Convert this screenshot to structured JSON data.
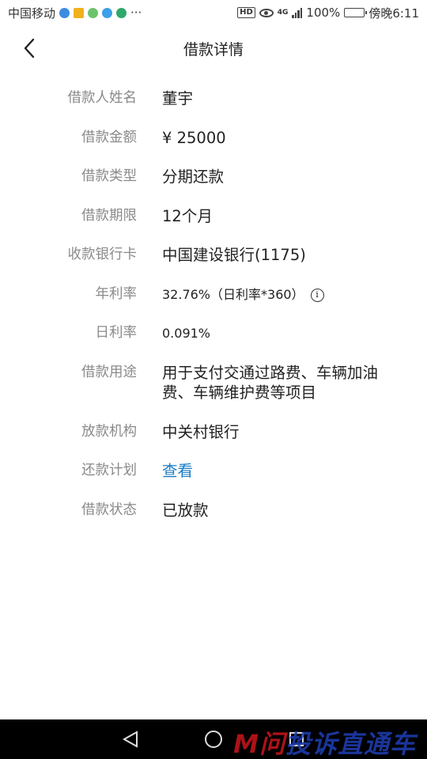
{
  "status_bar": {
    "carrier": "中国移动",
    "more": "···",
    "hd_badge": "HD",
    "network": "4G",
    "battery": "100%",
    "time": "傍晚6:11",
    "battery_level": 1.0
  },
  "header": {
    "title": "借款详情",
    "back_icon": "chevron-left-icon"
  },
  "details": [
    {
      "label": "借款人姓名",
      "value": "董宇"
    },
    {
      "label": "借款金额",
      "value": "¥ 25000"
    },
    {
      "label": "借款类型",
      "value": "分期还款"
    },
    {
      "label": "借款期限",
      "value": "12个月"
    },
    {
      "label": "收款银行卡",
      "value": "中国建设银行(1175)"
    },
    {
      "label": "年利率",
      "value": "32.76%（日利率*360）",
      "info_glyph": "i"
    },
    {
      "label": "日利率",
      "value": "0.091%"
    },
    {
      "label": "借款用途",
      "value": "用于支付交通过路费、车辆加油费、车辆维护费等项目"
    },
    {
      "label": "放款机构",
      "value": "中关村银行"
    },
    {
      "label": "还款计划",
      "value": "查看"
    },
    {
      "label": "借款状态",
      "value": "已放款"
    }
  ],
  "nav_bar": {
    "back": "back-triangle-icon",
    "home": "home-circle-icon",
    "recents": "recents-square-icon"
  },
  "watermark": {
    "part_a": "M问",
    "part_b": "投诉直通车"
  },
  "colors": {
    "link": "#1a7cc5",
    "label": "#8a8a8a",
    "text": "#222222",
    "nav_bg": "#000000"
  }
}
